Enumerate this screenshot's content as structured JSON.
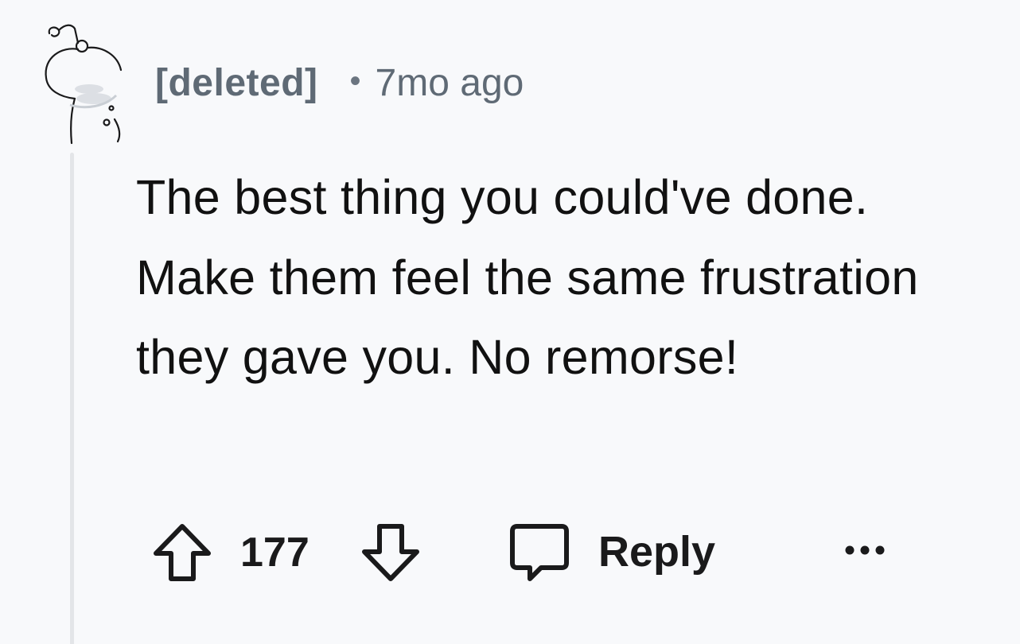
{
  "comment": {
    "author": "[deleted]",
    "separator": "•",
    "timestamp": "7mo ago",
    "body": "The best thing you could've done. Make them feel the same frustration they gave you. No remorse!"
  },
  "actions": {
    "upvote_icon": "arrow-up-outline-icon",
    "score": "177",
    "downvote_icon": "arrow-down-outline-icon",
    "reply_icon": "speech-bubble-icon",
    "reply_label": "Reply",
    "more_icon": "ellipsis-icon"
  },
  "colors": {
    "background": "#f8f9fb",
    "meta_text": "#5f6a75",
    "body_text": "#111111",
    "thread_line": "#e3e5e8"
  }
}
